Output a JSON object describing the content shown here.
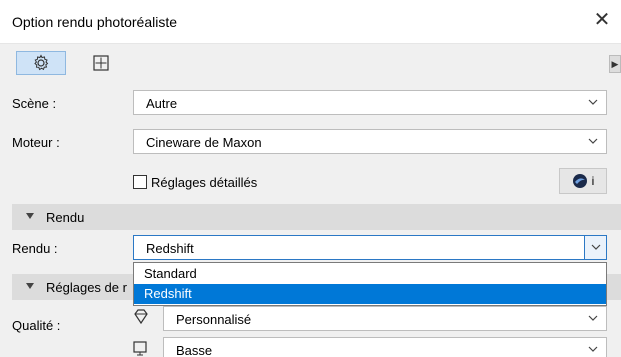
{
  "window": {
    "title": "Option rendu photoréaliste",
    "close_glyph": "✕"
  },
  "toolbar": {
    "settings_icon": "gear-icon",
    "size_icon": "size-frame-icon",
    "expand_glyph": "▶"
  },
  "rows": {
    "scene_label": "Scène :",
    "scene_value": "Autre",
    "engine_label": "Moteur :",
    "engine_value": "Cineware de Maxon",
    "detailed_settings_label": "Réglages détaillés",
    "info_letter": "i"
  },
  "section_rendu": {
    "header": "Rendu",
    "render_label": "Rendu :",
    "render_value": "Redshift",
    "dropdown_options": [
      "Standard",
      "Redshift"
    ]
  },
  "section_reglages": {
    "header": "Réglages de r",
    "quality_label": "Qualité :",
    "quality_value": "Personnalisé",
    "second_value": "Basse"
  },
  "colors": {
    "selection": "#0078d7",
    "active_tool": "#cfe3f7"
  }
}
